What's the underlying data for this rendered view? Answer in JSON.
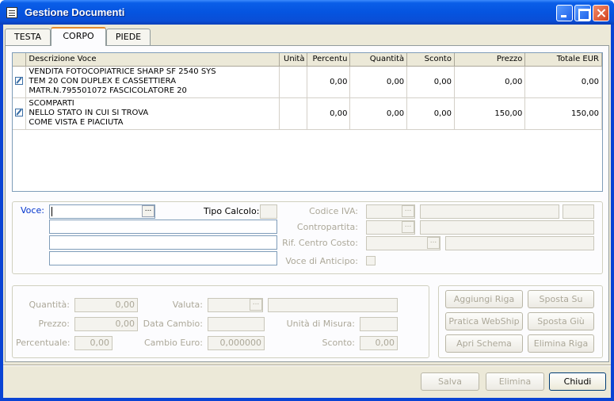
{
  "window": {
    "title": "Gestione Documenti"
  },
  "tabs": [
    "TESTA",
    "CORPO",
    "PIEDE"
  ],
  "grid": {
    "columns": [
      "Descrizione Voce",
      "Unità",
      "Percentu",
      "Quantità",
      "Sconto",
      "Prezzo",
      "Totale EUR"
    ],
    "rows": [
      {
        "desc": [
          "VENDITA FOTOCOPIATRICE SHARP SF 2540 SYS",
          "TEM 20 CON DUPLEX E CASSETTIERA",
          "MATR.N.795501072 FASCICOLATORE 20"
        ],
        "unita": "",
        "percentuale": "0,00",
        "quantita": "0,00",
        "sconto": "0,00",
        "prezzo": "0,00",
        "totale": "0,00"
      },
      {
        "desc": [
          "SCOMPARTI",
          "NELLO STATO IN CUI SI TROVA",
          "COME VISTA E PIACIUTA"
        ],
        "unita": "",
        "percentuale": "0,00",
        "quantita": "0,00",
        "sconto": "0,00",
        "prezzo": "150,00",
        "totale": "150,00"
      }
    ]
  },
  "voce": {
    "label": "Voce:",
    "tipo_calcolo_label": "Tipo Calcolo:",
    "codice_iva_label": "Codice IVA:",
    "contropartita_label": "Contropartita:",
    "centro_costo_label": "Rif. Centro Costo:",
    "anticipo_label": "Voce di Anticipo:"
  },
  "values": {
    "quantita_label": "Quantità:",
    "quantita": "0,00",
    "prezzo_label": "Prezzo:",
    "prezzo": "0,00",
    "percentuale_label": "Percentuale:",
    "percentuale": "0,00",
    "valuta_label": "Valuta:",
    "data_cambio_label": "Data Cambio:",
    "cambio_euro_label": "Cambio Euro:",
    "cambio_euro": "0,000000",
    "unita_misura_label": "Unità di Misura:",
    "sconto_label": "Sconto:",
    "sconto": "0,00"
  },
  "row_buttons": {
    "aggiungi": "Aggiungi Riga",
    "sposta_su": "Sposta Su",
    "webship": "Pratica WebShip",
    "sposta_giu": "Sposta Giù",
    "schema": "Apri Schema",
    "elimina_riga": "Elimina Riga"
  },
  "footer": {
    "salva": "Salva",
    "elimina": "Elimina",
    "chiudi": "Chiudi"
  },
  "dots_label": "..."
}
